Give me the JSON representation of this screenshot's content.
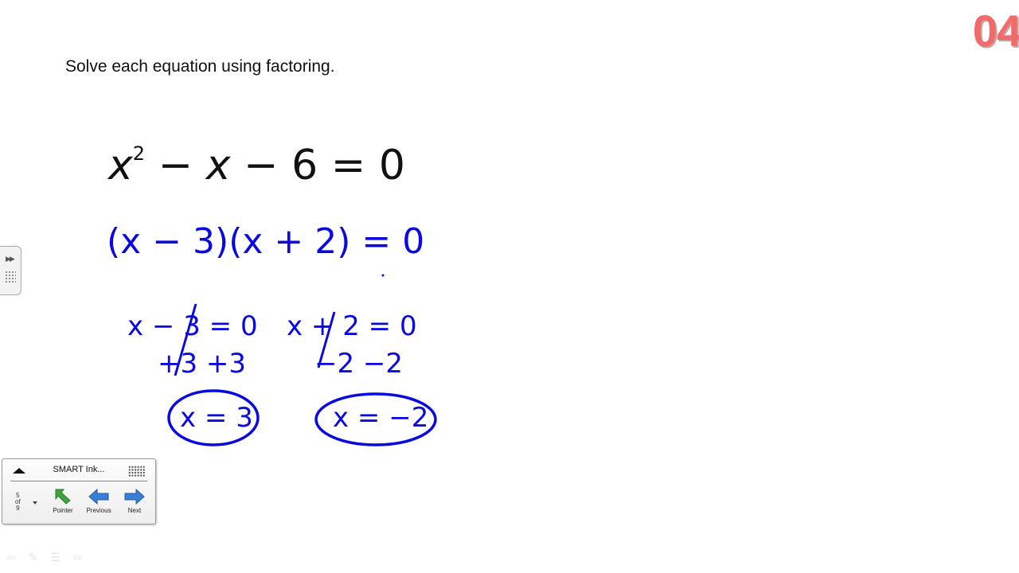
{
  "slide": {
    "instruction": "Solve each equation using factoring.",
    "timer_label": "04",
    "equation": {
      "var1": "x",
      "exp": "2",
      "mid": " − ",
      "var2": "x",
      "rest": " − 6 = 0"
    }
  },
  "handwriting": {
    "factored": "(x − 3)(x + 2) = 0",
    "left_eq": "x − 3 = 0",
    "left_step": "+3   +3",
    "left_solution": "x = 3",
    "right_eq": "x + 2 = 0",
    "right_step": "−2   −2",
    "right_solution": "x = −2",
    "ink_color": "#0a0ae0"
  },
  "smart_panel": {
    "title": "SMART Ink...",
    "page_current": "5",
    "page_of": "of",
    "page_total": "9",
    "buttons": [
      {
        "label": "Pointer",
        "icon": "pointer-arrow-icon"
      },
      {
        "label": "Previous",
        "icon": "previous-arrow-icon"
      },
      {
        "label": "Next",
        "icon": "next-arrow-icon"
      }
    ]
  },
  "colors": {
    "timer": "#f26a6a",
    "pointer_icon": "#3aa53a",
    "nav_icon": "#3a7fd6"
  }
}
